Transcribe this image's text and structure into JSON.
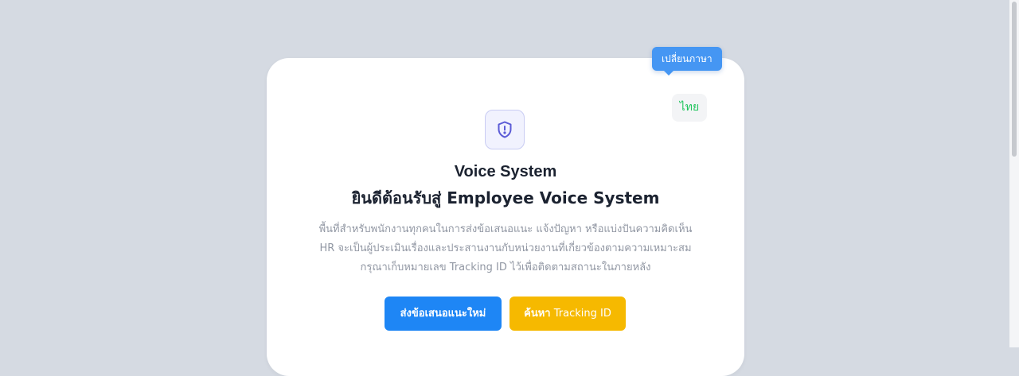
{
  "language": {
    "tooltip": "เปลี่ยนภาษา",
    "current": "ไทย",
    "accent": "#22c55e"
  },
  "logo": {
    "icon": "shield-alert-icon",
    "color": "#5b5bd6"
  },
  "hero": {
    "app_name": "Voice System",
    "headline": "ยินดีต้อนรับสู่ Employee Voice System",
    "description": [
      "พื้นที่สำหรับพนักงานทุกคนในการส่งข้อเสนอแนะ แจ้งปัญหา หรือแบ่งปันความคิดเห็น",
      "HR จะเป็นผู้ประเมินเรื่องและประสานงานกับหน่วยงานที่เกี่ยวข้องตามความเหมาะสม",
      "กรุณาเก็บหมายเลข Tracking ID ไว้เพื่อติดตามสถานะในภายหลัง"
    ]
  },
  "actions": {
    "new_suggestion": "ส่งข้อเสนอแนะใหม่",
    "search_prefix": "ค้นหา",
    "search_suffix": "Tracking ID",
    "primary_color": "#1e86f5",
    "secondary_color": "#f6b900"
  }
}
